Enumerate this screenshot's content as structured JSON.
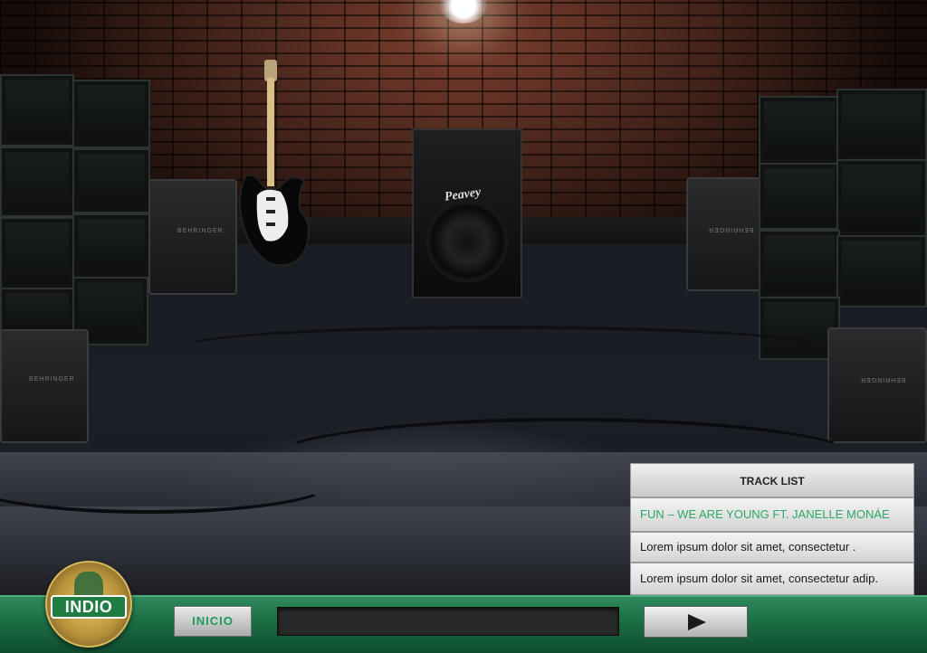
{
  "app": {
    "accent_color": "#1f9a5c",
    "background_scene": "stage-with-speakers"
  },
  "brand": {
    "logo_text": "INDIO",
    "amp_brand": "BEHRINGER",
    "pa_brand": "Peavey"
  },
  "tracklist": {
    "title": "TRACK LIST",
    "items": [
      {
        "label": "FUN  – WE ARE YOUNG FT. JANELLE MONÁE",
        "active": true
      },
      {
        "label": "Lorem ipsum dolor sit amet, consectetur .",
        "active": false
      },
      {
        "label": "Lorem ipsum dolor sit amet, consectetur adip.",
        "active": false
      }
    ]
  },
  "controls": {
    "home_label": "INICIO",
    "play_icon": "play-icon",
    "progress": 0
  }
}
